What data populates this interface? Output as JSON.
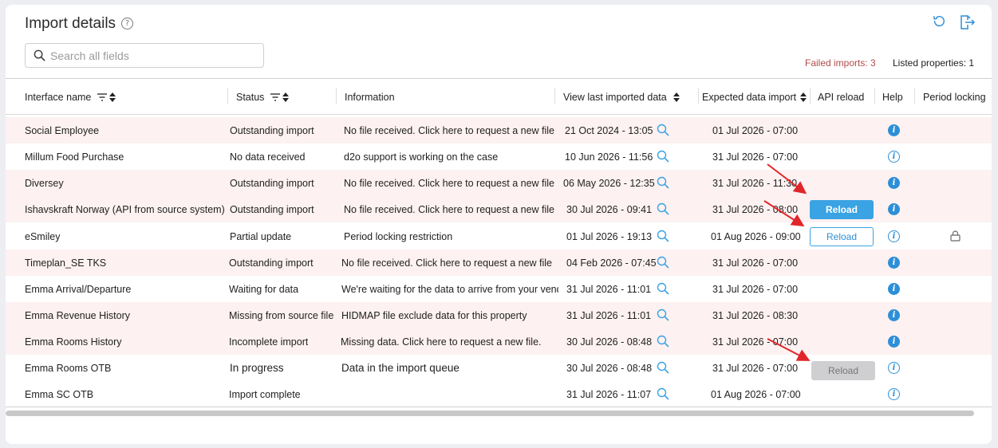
{
  "header": {
    "title": "Import details",
    "search_placeholder": "Search all fields",
    "failed_imports": "Failed imports: 3",
    "listed_properties": "Listed properties: 1"
  },
  "columns": [
    "Interface name",
    "Status",
    "Information",
    "View last imported data",
    "Expected data import",
    "API reload",
    "Help",
    "Period locking"
  ],
  "rows": [
    {
      "name": "Social Employee",
      "status": "Outstanding import",
      "info": "No file received. Click here to request a new file",
      "last": "21 Oct 2024 - 13:05",
      "expected": "01 Jul 2026 - 07:00",
      "reload": "",
      "help": "solid",
      "lock": false
    },
    {
      "name": "Millum Food Purchase",
      "status": "No data received",
      "info": "d2o support is working on the case",
      "last": "10 Jun 2026 - 11:56",
      "expected": "31 Jul 2026 - 07:00",
      "reload": "",
      "help": "outline",
      "lock": false
    },
    {
      "name": "Diversey",
      "status": "Outstanding import",
      "info": "No file received. Click here to request a new file",
      "last": "06 May 2026 - 12:35",
      "expected": "31 Jul 2026 - 11:30",
      "reload": "",
      "help": "solid",
      "lock": false
    },
    {
      "name": "Ishavskraft Norway (API from source system)",
      "status": "Outstanding import",
      "info": "No file received. Click here to request a new file",
      "last": "30 Jul 2026 - 09:41",
      "expected": "31 Jul 2026 - 08:00",
      "reload": "Reload",
      "reload_style": "primary",
      "help": "solid",
      "lock": false
    },
    {
      "name": "eSmiley",
      "status": "Partial update",
      "info": "Period locking restriction",
      "last": "01 Jul 2026 - 19:13",
      "expected": "01 Aug 2026 - 09:00",
      "reload": "Reload",
      "reload_style": "outline",
      "help": "outline",
      "lock": true
    },
    {
      "name": "Timeplan_SE TKS",
      "status": "Outstanding import",
      "info": "No file received. Click here to request a new file",
      "last": "04 Feb 2026 - 07:45",
      "expected": "31 Jul 2026 - 07:00",
      "reload": "",
      "help": "solid",
      "lock": false
    },
    {
      "name": "Emma Arrival/Departure",
      "status": "Waiting for data",
      "info": "We're waiting for the data to arrive from your vend",
      "last": "31 Jul 2026 - 11:01",
      "expected": "31 Jul 2026 - 07:00",
      "reload": "",
      "help": "solid",
      "lock": false
    },
    {
      "name": "Emma Revenue History",
      "status": "Missing from source file",
      "info": "HIDMAP file exclude data for this property",
      "last": "31 Jul 2026 - 11:01",
      "expected": "31 Jul 2026 - 08:30",
      "reload": "",
      "help": "solid",
      "lock": false
    },
    {
      "name": "Emma Rooms History",
      "status": "Incomplete import",
      "info": "Missing data. Click here to request a new file.",
      "last": "30 Jul 2026 - 08:48",
      "expected": "31 Jul 2026 - 07:00",
      "reload": "",
      "help": "solid",
      "lock": false
    },
    {
      "name": "Emma Rooms OTB",
      "status": "In progress",
      "info": "Data in the import queue",
      "last": "30 Jul 2026 - 08:48",
      "expected": "31 Jul 2026 - 07:00",
      "reload": "Reload",
      "reload_style": "disabled",
      "help": "outline",
      "lock": false
    },
    {
      "name": "Emma SC OTB",
      "status": "Import complete",
      "info": "",
      "last": "31 Jul 2026 - 11:07",
      "expected": "01 Aug 2026 - 07:00",
      "reload": "",
      "help": "outline",
      "lock": false
    }
  ],
  "colors": {
    "accent": "#3aa3e3",
    "failed_text": "#b04a4a",
    "row_highlight": "#fdf1f1",
    "annotation_arrow": "#e0262a"
  },
  "icons": {
    "title_help": "question-circle-icon",
    "search": "search-icon",
    "refresh": "refresh-icon",
    "export": "export-icon",
    "filter": "filter-icon",
    "sort": "sort-icon",
    "view": "magnifier-icon",
    "help": "info-icon",
    "lock": "lock-icon"
  }
}
